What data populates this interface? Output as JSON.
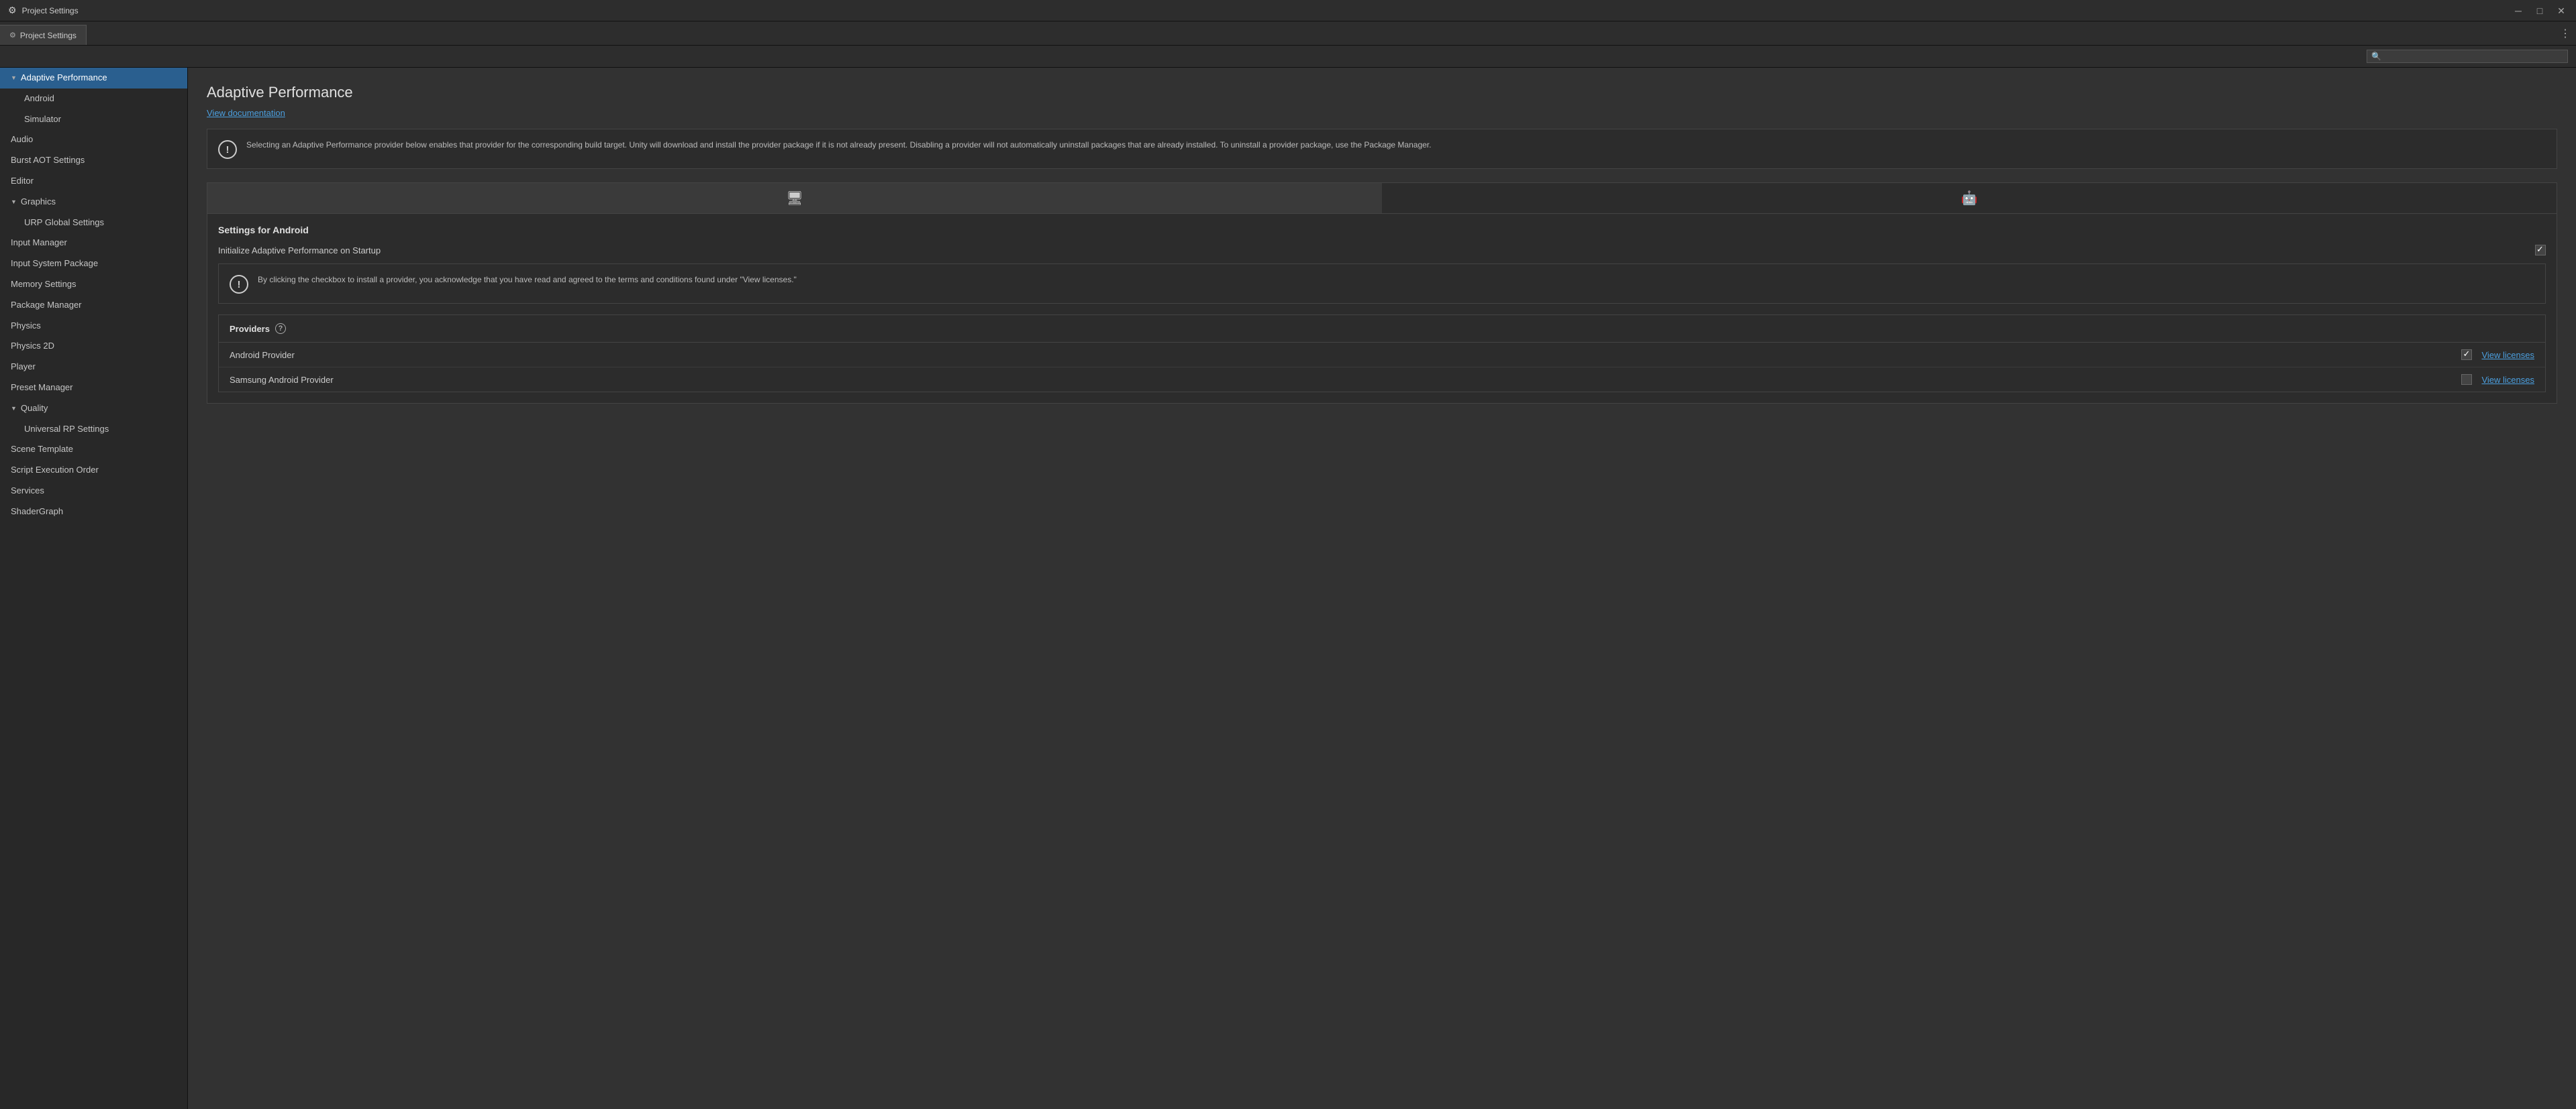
{
  "window": {
    "title": "Project Settings",
    "controls": {
      "minimize": "─",
      "maximize": "□",
      "close": "✕"
    }
  },
  "tab": {
    "icon": "⚙",
    "label": "Project Settings"
  },
  "search": {
    "placeholder": ""
  },
  "sidebar": {
    "items": [
      {
        "id": "adaptive-performance",
        "label": "Adaptive Performance",
        "level": 0,
        "triangle": "down",
        "active": true
      },
      {
        "id": "android",
        "label": "Android",
        "level": 1,
        "active": false
      },
      {
        "id": "simulator",
        "label": "Simulator",
        "level": 1,
        "active": false
      },
      {
        "id": "audio",
        "label": "Audio",
        "level": 0,
        "active": false
      },
      {
        "id": "burst-aot",
        "label": "Burst AOT Settings",
        "level": 0,
        "active": false
      },
      {
        "id": "editor",
        "label": "Editor",
        "level": 0,
        "active": false
      },
      {
        "id": "graphics",
        "label": "Graphics",
        "level": 0,
        "triangle": "down",
        "active": false
      },
      {
        "id": "urp-global",
        "label": "URP Global Settings",
        "level": 1,
        "active": false
      },
      {
        "id": "input-manager",
        "label": "Input Manager",
        "level": 0,
        "active": false
      },
      {
        "id": "input-system",
        "label": "Input System Package",
        "level": 0,
        "active": false
      },
      {
        "id": "memory-settings",
        "label": "Memory Settings",
        "level": 0,
        "active": false
      },
      {
        "id": "package-manager",
        "label": "Package Manager",
        "level": 0,
        "active": false
      },
      {
        "id": "physics",
        "label": "Physics",
        "level": 0,
        "active": false
      },
      {
        "id": "physics-2d",
        "label": "Physics 2D",
        "level": 0,
        "active": false
      },
      {
        "id": "player",
        "label": "Player",
        "level": 0,
        "active": false
      },
      {
        "id": "preset-manager",
        "label": "Preset Manager",
        "level": 0,
        "active": false
      },
      {
        "id": "quality",
        "label": "Quality",
        "level": 0,
        "triangle": "down",
        "active": false
      },
      {
        "id": "universal-rp",
        "label": "Universal RP Settings",
        "level": 1,
        "active": false
      },
      {
        "id": "scene-template",
        "label": "Scene Template",
        "level": 0,
        "active": false
      },
      {
        "id": "script-execution",
        "label": "Script Execution Order",
        "level": 0,
        "active": false
      },
      {
        "id": "services",
        "label": "Services",
        "level": 0,
        "active": false
      },
      {
        "id": "shadergraph",
        "label": "ShaderGraph",
        "level": 0,
        "active": false
      }
    ]
  },
  "content": {
    "title": "Adaptive Performance",
    "view_doc_label": "View documentation",
    "info_text": "Selecting an Adaptive Performance provider below enables that provider for the corresponding build target. Unity will download and install the provider package if it is not already present. Disabling a provider will not automatically uninstall packages that are already installed. To uninstall a provider package, use the Package Manager.",
    "platform_tabs": [
      {
        "id": "desktop",
        "icon": "🖥",
        "active": true
      },
      {
        "id": "android",
        "icon": "📱",
        "active": false
      }
    ],
    "settings_for_android": {
      "title": "Settings for Android",
      "initialize_label": "Initialize Adaptive Performance on Startup",
      "initialize_checked": true
    },
    "warn_text": "By clicking the checkbox to install a provider, you acknowledge that you have read and agreed to the terms and conditions found under \"View licenses.\"",
    "providers": {
      "title": "Providers",
      "items": [
        {
          "name": "Android Provider",
          "checked": true,
          "view_licenses": "View licenses"
        },
        {
          "name": "Samsung Android Provider",
          "checked": false,
          "view_licenses": "View licenses"
        }
      ]
    }
  }
}
